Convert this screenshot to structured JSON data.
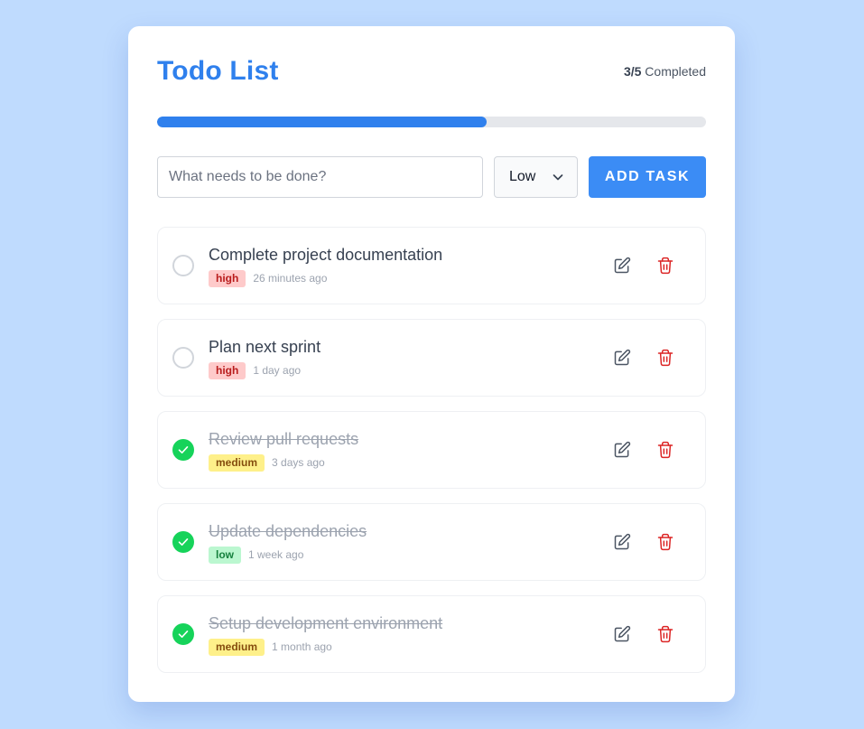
{
  "header": {
    "title": "Todo List",
    "completed_count": "3/5",
    "completed_label": "Completed"
  },
  "progress": {
    "completed": 3,
    "total": 5,
    "fraction": 0.6,
    "color": "#2f80ed"
  },
  "add_form": {
    "placeholder": "What needs to be done?",
    "value": "",
    "priority_selected": "Low",
    "add_button_label": "ADD TASK"
  },
  "tasks": [
    {
      "title": "Complete project documentation",
      "priority": "high",
      "time": "26 minutes ago",
      "completed": false
    },
    {
      "title": "Plan next sprint",
      "priority": "high",
      "time": "1 day ago",
      "completed": false
    },
    {
      "title": "Review pull requests",
      "priority": "medium",
      "time": "3 days ago",
      "completed": true
    },
    {
      "title": "Update dependencies",
      "priority": "low",
      "time": "1 week ago",
      "completed": true
    },
    {
      "title": "Setup development environment",
      "priority": "medium",
      "time": "1 month ago",
      "completed": true
    }
  ],
  "icons": {
    "edit": "pencil-icon",
    "delete": "trash-icon",
    "check": "check-icon",
    "select": "chevron-down-icon"
  },
  "colors": {
    "background": "#bfdbfe",
    "accent": "#2f80ed",
    "button": "#3b8cf5",
    "done": "#16d35a",
    "delete": "#dc2626"
  }
}
